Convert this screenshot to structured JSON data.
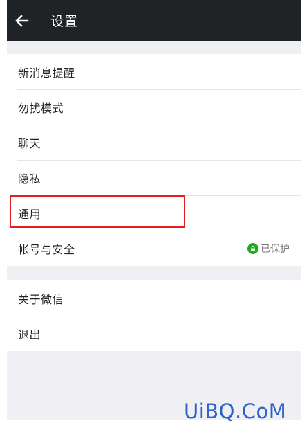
{
  "header": {
    "title": "设置"
  },
  "group1": [
    {
      "label": "新消息提醒"
    },
    {
      "label": "勿扰模式"
    },
    {
      "label": "聊天"
    },
    {
      "label": "隐私"
    },
    {
      "label": "通用",
      "highlighted": true
    },
    {
      "label": "帐号与安全",
      "status": "已保护"
    }
  ],
  "group2": [
    {
      "label": "关于微信"
    },
    {
      "label": "退出"
    }
  ],
  "watermark": "UiBQ.CoM",
  "colors": {
    "header_bg": "#1f2326",
    "page_bg": "#efeff4",
    "highlight": "#e02020",
    "protected_green": "#1aad19",
    "watermark": "#2d62c8"
  },
  "icons": {
    "back": "arrow-left-icon",
    "status": "shield-check-icon"
  }
}
